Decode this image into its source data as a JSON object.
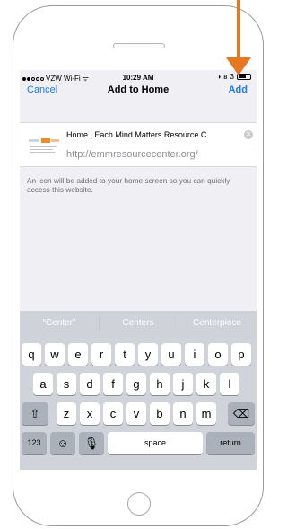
{
  "status_bar": {
    "carrier": "VZW Wi-Fi",
    "time": "10:29 AM",
    "battery_label": "3"
  },
  "nav": {
    "cancel": "Cancel",
    "title": "Add to Home",
    "add": "Add"
  },
  "bookmark": {
    "title": "Home | Each Mind Matters Resource C",
    "url": "http://emmresourcecenter.org/",
    "hint": "An icon will be added to your home screen so you can quickly access this website."
  },
  "keyboard": {
    "predictions": [
      "“Center”",
      "Centers",
      "Centerpiece"
    ],
    "row1": [
      "q",
      "w",
      "e",
      "r",
      "t",
      "y",
      "u",
      "i",
      "o",
      "p"
    ],
    "row2": [
      "a",
      "s",
      "d",
      "f",
      "g",
      "h",
      "j",
      "k",
      "l"
    ],
    "row3": [
      "z",
      "x",
      "c",
      "v",
      "b",
      "n",
      "m"
    ],
    "numbers": "123",
    "space": "space",
    "return": "return"
  },
  "colors": {
    "accent": "#1e7ae6",
    "arrow": "#e87722"
  }
}
